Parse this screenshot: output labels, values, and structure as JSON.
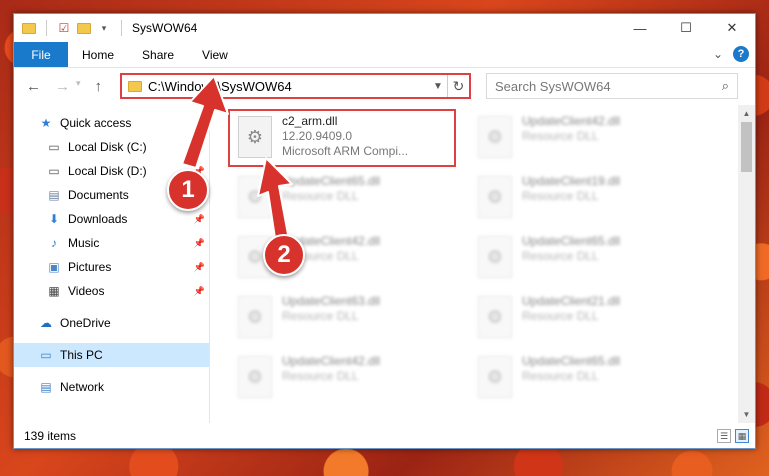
{
  "window": {
    "title": "SysWOW64",
    "controls": {
      "minimize": "—",
      "maximize": "☐",
      "close": "✕"
    }
  },
  "ribbon": {
    "tabs": [
      "File",
      "Home",
      "Share",
      "View"
    ],
    "expand_glyph": "⌄",
    "help_glyph": "?"
  },
  "address": {
    "path": "C:\\Windows\\SysWOW64",
    "search_placeholder": "Search SysWOW64"
  },
  "sidebar": {
    "items": [
      {
        "label": "Quick access",
        "icon": "star-icon",
        "glyph": "★",
        "color": "#2f7fd6"
      },
      {
        "label": "Local Disk (C:)",
        "icon": "drive-icon",
        "glyph": "▭",
        "color": "#555555",
        "pinned": true
      },
      {
        "label": "Local Disk (D:)",
        "icon": "drive-icon",
        "glyph": "▭",
        "color": "#555555",
        "pinned": true
      },
      {
        "label": "Documents",
        "icon": "document-icon",
        "glyph": "▤",
        "color": "#6b7fa0",
        "pinned": true
      },
      {
        "label": "Downloads",
        "icon": "download-icon",
        "glyph": "⬇",
        "color": "#2f7fd6",
        "pinned": true
      },
      {
        "label": "Music",
        "icon": "music-icon",
        "glyph": "♪",
        "color": "#2f7fd6",
        "pinned": true
      },
      {
        "label": "Pictures",
        "icon": "picture-icon",
        "glyph": "▣",
        "color": "#4a86c8",
        "pinned": true
      },
      {
        "label": "Videos",
        "icon": "video-icon",
        "glyph": "▦",
        "color": "#444444",
        "pinned": true
      },
      {
        "label": "OneDrive",
        "icon": "cloud-icon",
        "glyph": "☁",
        "color": "#1f6fc5"
      },
      {
        "label": "This PC",
        "icon": "computer-icon",
        "glyph": "▭",
        "color": "#3d7fc8",
        "selected": true
      },
      {
        "label": "Network",
        "icon": "network-icon",
        "glyph": "▤",
        "color": "#3d7fc8"
      }
    ]
  },
  "files": [
    {
      "name": "c2_arm.dll",
      "line2": "12.20.9409.0",
      "line3": "Microsoft ARM Compi...",
      "highlighted": true
    },
    {
      "name": "UpdateClient42.dll",
      "line2": "Resource DLL"
    },
    {
      "name": "UpdateClient65.dll",
      "line2": "Resource DLL"
    },
    {
      "name": "UpdateClient19.dll",
      "line2": "Resource DLL"
    },
    {
      "name": "UpdateClient42.dll",
      "line2": "Resource DLL"
    },
    {
      "name": "UpdateClient65.dll",
      "line2": "Resource DLL"
    },
    {
      "name": "UpdateClient63.dll",
      "line2": "Resource DLL"
    },
    {
      "name": "UpdateClient21.dll",
      "line2": "Resource DLL"
    },
    {
      "name": "UpdateClient42.dll",
      "line2": "Resource DLL"
    },
    {
      "name": "UpdateClient65.dll",
      "line2": "Resource DLL"
    }
  ],
  "status": {
    "item_count": "139 items"
  },
  "annotations": {
    "step1": "1",
    "step2": "2",
    "highlight_color": "#e04040"
  }
}
